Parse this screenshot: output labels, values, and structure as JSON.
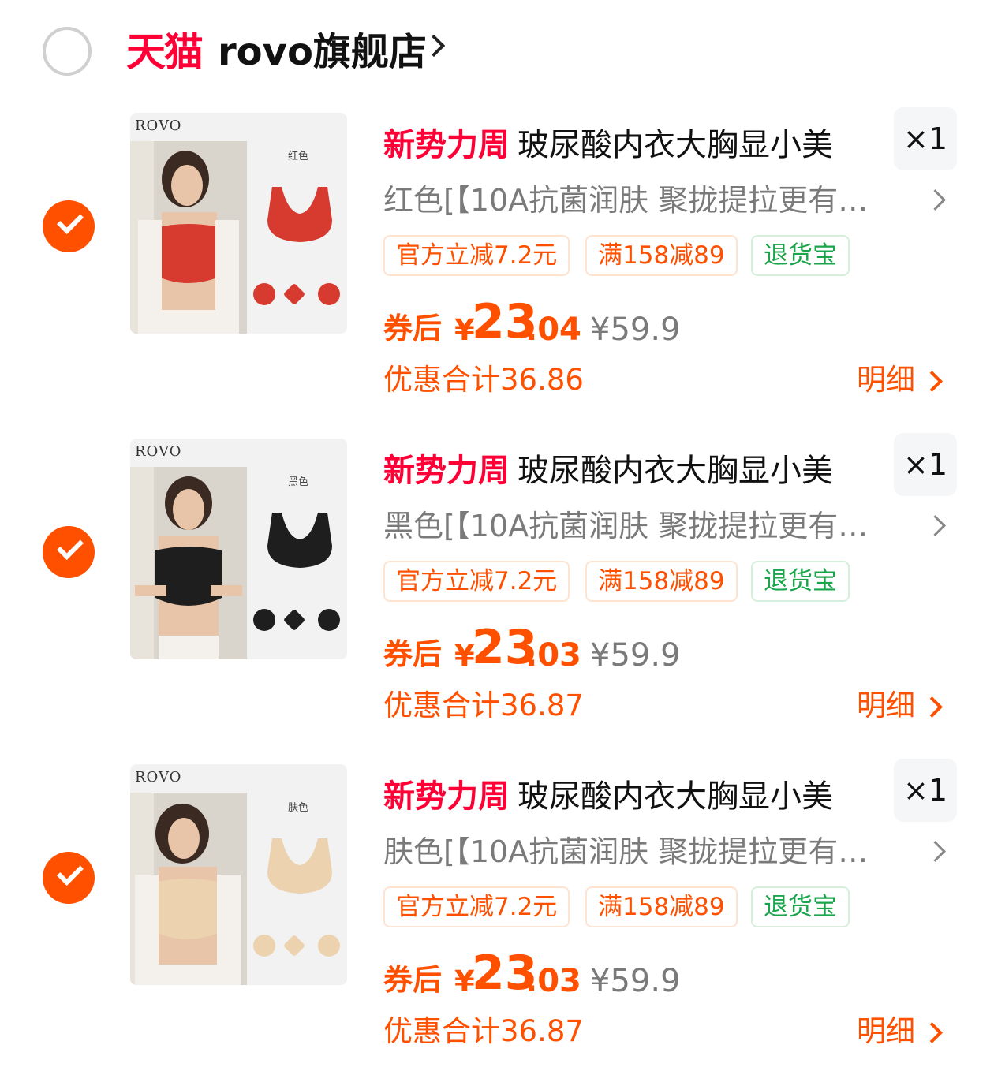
{
  "store": {
    "logo_text": "天猫",
    "name": "rovo旗舰店"
  },
  "items": [
    {
      "tag": "新势力周",
      "title": "玻尿酸内衣大胸显小美",
      "quantity": "×1",
      "sku": "红色[【10A抗菌润肤 聚拢提拉更有…",
      "thumb_brand": "ROVO",
      "thumb_color_label": "红色",
      "product_color": "#d73a2f",
      "promo_tags": [
        {
          "label": "官方立减7.2元",
          "type": "orange"
        },
        {
          "label": "满158减89",
          "type": "orange"
        },
        {
          "label": "退货宝",
          "type": "green"
        }
      ],
      "price_prefix": "券后",
      "currency": "¥",
      "price_int": "23",
      "price_dec": ".04",
      "original_price": "¥59.9",
      "discount_total": "优惠合计36.86",
      "detail_label": "明细"
    },
    {
      "tag": "新势力周",
      "title": "玻尿酸内衣大胸显小美",
      "quantity": "×1",
      "sku": "黑色[【10A抗菌润肤 聚拢提拉更有…",
      "thumb_brand": "ROVO",
      "thumb_color_label": "黑色",
      "product_color": "#1e1e1e",
      "promo_tags": [
        {
          "label": "官方立减7.2元",
          "type": "orange"
        },
        {
          "label": "满158减89",
          "type": "orange"
        },
        {
          "label": "退货宝",
          "type": "green"
        }
      ],
      "price_prefix": "券后",
      "currency": "¥",
      "price_int": "23",
      "price_dec": ".03",
      "original_price": "¥59.9",
      "discount_total": "优惠合计36.87",
      "detail_label": "明细"
    },
    {
      "tag": "新势力周",
      "title": "玻尿酸内衣大胸显小美",
      "quantity": "×1",
      "sku": "肤色[【10A抗菌润肤 聚拢提拉更有…",
      "thumb_brand": "ROVO",
      "thumb_color_label": "肤色",
      "product_color": "#ecd2ae",
      "promo_tags": [
        {
          "label": "官方立减7.2元",
          "type": "orange"
        },
        {
          "label": "满158减89",
          "type": "orange"
        },
        {
          "label": "退货宝",
          "type": "green"
        }
      ],
      "price_prefix": "券后",
      "currency": "¥",
      "price_int": "23",
      "price_dec": ".03",
      "original_price": "¥59.9",
      "discount_total": "优惠合计36.87",
      "detail_label": "明细"
    }
  ]
}
